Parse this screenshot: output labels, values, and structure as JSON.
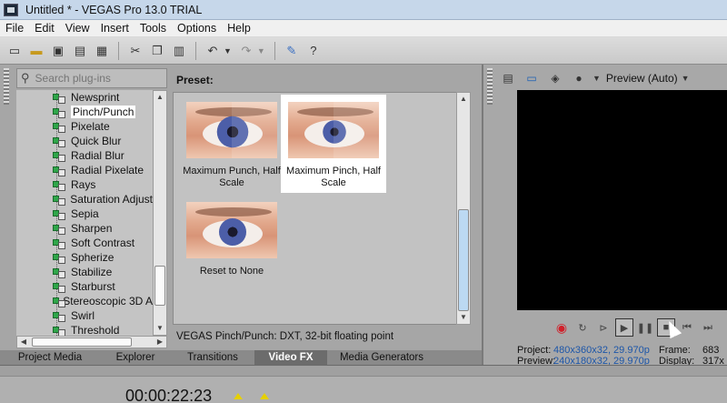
{
  "window": {
    "title": "Untitled * - VEGAS Pro 13.0 TRIAL"
  },
  "menu": [
    "File",
    "Edit",
    "View",
    "Insert",
    "Tools",
    "Options",
    "Help"
  ],
  "toolbar": {
    "icons": [
      "new-icon",
      "open-icon",
      "save-icon",
      "save-as-icon",
      "properties-icon",
      "cut-icon",
      "copy-icon",
      "paste-icon",
      "undo-icon",
      "redo-icon",
      "paint-icon",
      "whats-this-icon"
    ]
  },
  "plugins": {
    "search_placeholder": "Search plug-ins",
    "items": [
      "Newsprint",
      "Pinch/Punch",
      "Pixelate",
      "Quick Blur",
      "Radial Blur",
      "Radial Pixelate",
      "Rays",
      "Saturation Adjust",
      "Sepia",
      "Sharpen",
      "Soft Contrast",
      "Spherize",
      "Stabilize",
      "Starburst",
      "Stereoscopic 3D A",
      "Swirl",
      "Threshold"
    ],
    "selected": "Pinch/Punch"
  },
  "preset": {
    "label": "Preset:",
    "items": [
      {
        "caption": "Maximum Punch, Half Scale",
        "selected": false
      },
      {
        "caption": "Maximum Pinch, Half Scale",
        "selected": true
      },
      {
        "caption": "Reset to None",
        "selected": false
      }
    ],
    "status": "VEGAS Pinch/Punch: DXT, 32-bit floating point"
  },
  "tabs": [
    {
      "label": "Project Media",
      "active": false
    },
    {
      "label": "Explorer",
      "active": false
    },
    {
      "label": "Transitions",
      "active": false
    },
    {
      "label": "Video FX",
      "active": true
    },
    {
      "label": "Media Generators",
      "active": false
    }
  ],
  "preview": {
    "mode": "Preview (Auto)",
    "project_label": "Project:",
    "project_value": "480x360x32, 29.970p",
    "preview_label": "Preview:",
    "preview_value": "240x180x32, 29.970p",
    "frame_label": "Frame:",
    "frame_value": "683",
    "display_label": "Display:",
    "display_value": "317x"
  },
  "timeline": {
    "timecode": "00:00:22:23"
  },
  "colors": {
    "info_value": "#1d56a8",
    "record": "#d0202a",
    "marker": "#e6d000"
  }
}
